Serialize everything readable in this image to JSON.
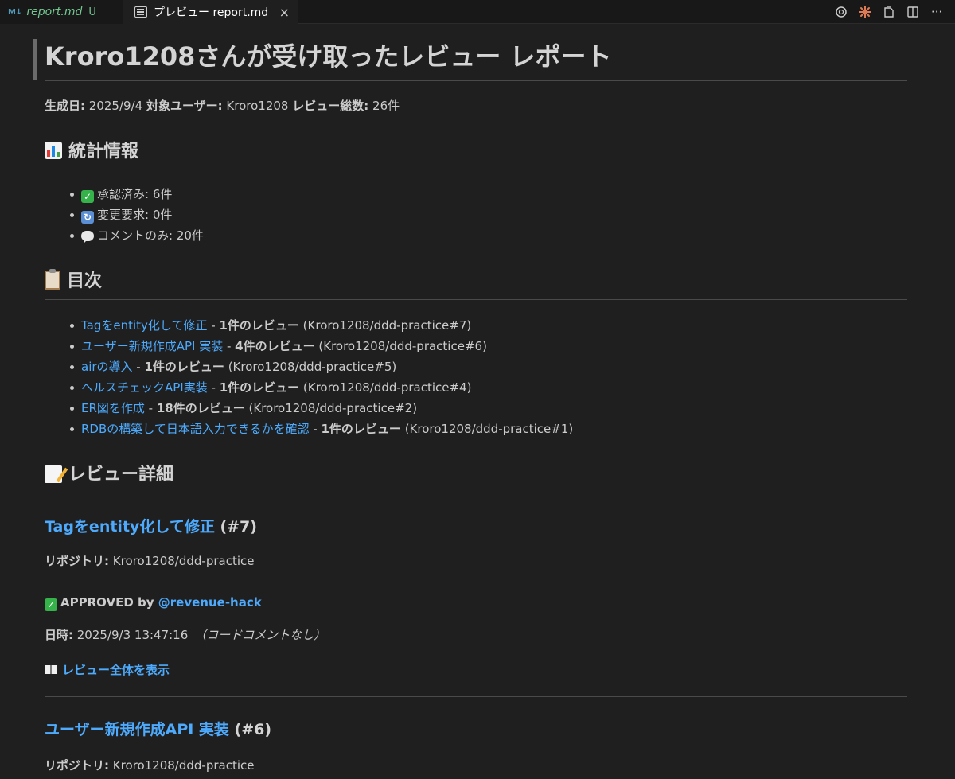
{
  "tabs": [
    {
      "icon": "M↓",
      "label": "report.md",
      "badge": "U"
    },
    {
      "label": "プレビュー report.md",
      "close": "×"
    }
  ],
  "actions": {
    "more": "···"
  },
  "report": {
    "title": "Kroro1208さんが受け取ったレビュー レポート",
    "meta": {
      "generated_label": "生成日:",
      "generated_value": "2025/9/4",
      "user_label": "対象ユーザー:",
      "user_value": "Kroro1208",
      "total_label": "レビュー総数:",
      "total_value": "26件"
    },
    "stats": {
      "heading": "統計情報",
      "approved": "承認済み: 6件",
      "changes": "変更要求: 0件",
      "comments": "コメントのみ: 20件"
    },
    "toc": {
      "heading": "目次",
      "items": [
        {
          "link": "Tagをentity化して修正",
          "sep": " - ",
          "count": "1件のレビュー",
          "ref": " (Kroro1208/ddd-practice#7)"
        },
        {
          "link": "ユーザー新規作成API 実装",
          "sep": " - ",
          "count": "4件のレビュー",
          "ref": " (Kroro1208/ddd-practice#6)"
        },
        {
          "link": "airの導入",
          "sep": " - ",
          "count": "1件のレビュー",
          "ref": " (Kroro1208/ddd-practice#5)"
        },
        {
          "link": "ヘルスチェックAPI実装",
          "sep": " - ",
          "count": "1件のレビュー",
          "ref": " (Kroro1208/ddd-practice#4)"
        },
        {
          "link": "ER図を作成",
          "sep": " - ",
          "count": "18件のレビュー",
          "ref": " (Kroro1208/ddd-practice#2)"
        },
        {
          "link": "RDBの構築して日本語入力できるかを確認",
          "sep": " - ",
          "count": "1件のレビュー",
          "ref": " (Kroro1208/ddd-practice#1)"
        }
      ]
    },
    "details": {
      "heading": "レビュー詳細",
      "reviews": [
        {
          "title_link": "Tagをentity化して修正",
          "title_num": " (#7)",
          "repo_label": "リポジトリ:",
          "repo_value": " Kroro1208/ddd-practice",
          "status": "APPROVED by ",
          "reviewer": "@revenue-hack",
          "date_label": "日時:",
          "date_value": " 2025/9/3 13:47:16",
          "note": "（コードコメントなし）",
          "view_all": "レビュー全体を表示"
        },
        {
          "title_link": "ユーザー新規作成API 実装",
          "title_num": " (#6)",
          "repo_label": "リポジトリ:",
          "repo_value": " Kroro1208/ddd-practice"
        }
      ]
    }
  }
}
